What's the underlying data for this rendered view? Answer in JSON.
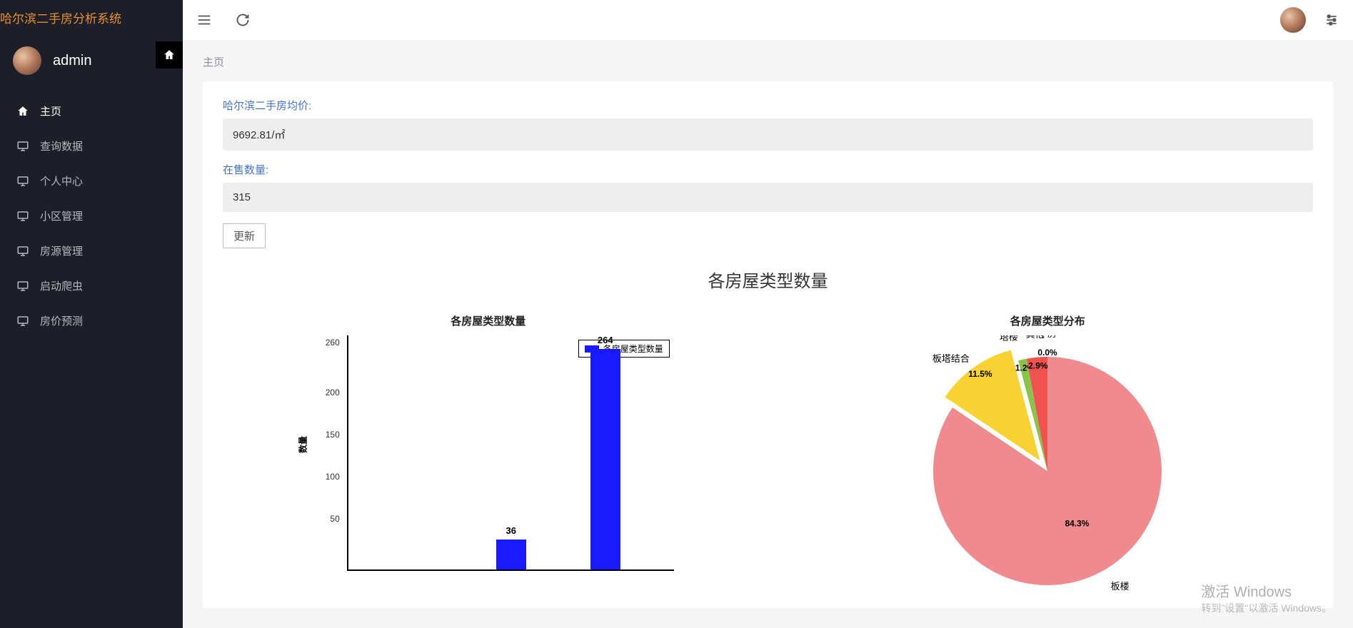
{
  "app_title": "哈尔滨二手房分析系统",
  "user": {
    "name": "admin"
  },
  "nav": {
    "items": [
      {
        "label": "主页",
        "icon": "home",
        "active": true
      },
      {
        "label": "查询数据",
        "icon": "monitor",
        "active": false
      },
      {
        "label": "个人中心",
        "icon": "monitor",
        "active": false
      },
      {
        "label": "小区管理",
        "icon": "monitor",
        "active": false
      },
      {
        "label": "房源管理",
        "icon": "monitor",
        "active": false
      },
      {
        "label": "启动爬虫",
        "icon": "monitor",
        "active": false
      },
      {
        "label": "房价预测",
        "icon": "monitor",
        "active": false
      }
    ]
  },
  "breadcrumb": "主页",
  "stats": {
    "avg_price_label": "哈尔滨二手房均价:",
    "avg_price_value": "9692.81/㎡",
    "on_sale_label": "在售数量:",
    "on_sale_value": "315",
    "update_btn": "更新"
  },
  "section_title": "各房屋类型数量",
  "chart_data": [
    {
      "type": "bar",
      "title": "各房屋类型数量",
      "legend": "各房屋类型数量",
      "ylabel": "数量",
      "ylim": [
        0,
        280
      ],
      "yticks": [
        50,
        100,
        150,
        200,
        260
      ],
      "categories": [
        "",
        "",
        ""
      ],
      "values": [
        null,
        36,
        264
      ],
      "value_labels": [
        "",
        "36",
        "264"
      ]
    },
    {
      "type": "pie",
      "title": "各房屋类型分布",
      "series": [
        {
          "name": "板楼",
          "value": 84.3,
          "label": "84.3%",
          "color": "#ef8a8e"
        },
        {
          "name": "板塔结合",
          "value": 11.5,
          "label": "11.5%",
          "color": "#f8d132",
          "exploded": true
        },
        {
          "name": "塔楼",
          "value": 1.2,
          "label": "1.2%",
          "color": "#8bc34a"
        },
        {
          "name": "其他",
          "value": 2.9,
          "label": "2.9%",
          "color": "#ef5350"
        },
        {
          "name": "平房",
          "value": 0.0,
          "label": "0.0%",
          "color": "#bdbdbd",
          "exploded": true
        }
      ]
    }
  ],
  "watermark": {
    "title": "激活 Windows",
    "sub": "转到\"设置\"以激活 Windows。"
  }
}
